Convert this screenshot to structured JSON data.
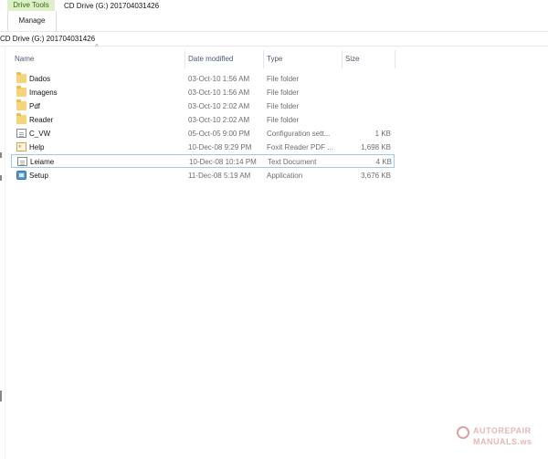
{
  "ribbon": {
    "context_group_label": "Drive Tools",
    "context_tab_label": "Manage",
    "window_title": "CD Drive (G:) 201704031426"
  },
  "address_bar": {
    "path": "CD Drive (G:) 201704031426"
  },
  "columns": {
    "name": "Name",
    "date": "Date modified",
    "type": "Type",
    "size": "Size"
  },
  "files": [
    {
      "name": "Dados",
      "date": "03-Oct-10 1:56 AM",
      "type": "File folder",
      "size": "",
      "icon": "folder-icon"
    },
    {
      "name": "Imagens",
      "date": "03-Oct-10 1:56 AM",
      "type": "File folder",
      "size": "",
      "icon": "folder-icon"
    },
    {
      "name": "Pdf",
      "date": "03-Oct-10 2:02 AM",
      "type": "File folder",
      "size": "",
      "icon": "folder-icon"
    },
    {
      "name": "Reader",
      "date": "03-Oct-10 2:02 AM",
      "type": "File folder",
      "size": "",
      "icon": "folder-icon"
    },
    {
      "name": "C_VW",
      "date": "05-Oct-05 9:00 PM",
      "type": "Configuration sett...",
      "size": "1 KB",
      "icon": "config-file-icon"
    },
    {
      "name": "Help",
      "date": "10-Dec-08 9:29 PM",
      "type": "Foxit Reader PDF ...",
      "size": "1,698 KB",
      "icon": "pdf-file-icon"
    },
    {
      "name": "Leiame",
      "date": "10-Dec-08 10:14 PM",
      "type": "Text Document",
      "size": "4 KB",
      "icon": "text-file-icon"
    },
    {
      "name": "Setup",
      "date": "11-Dec-08 5:19 AM",
      "type": "Application",
      "size": "3,676 KB",
      "icon": "application-icon"
    }
  ],
  "watermark": {
    "line1": "AUTOREPAIR",
    "line2": "MANUALS.ws"
  }
}
